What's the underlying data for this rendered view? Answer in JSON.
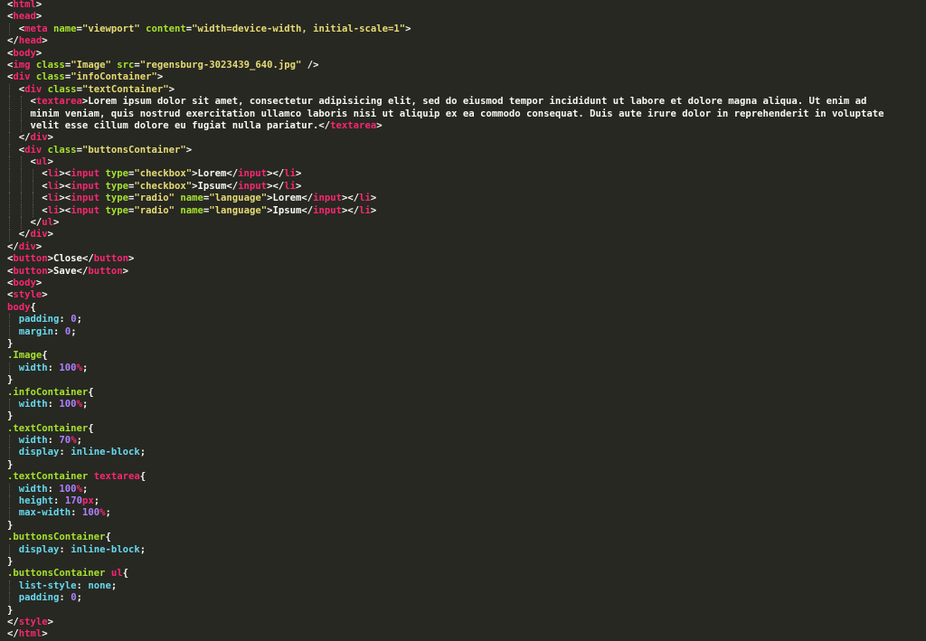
{
  "editor": {
    "colors": {
      "background": "#272822",
      "text": "#f8f8f2",
      "tag": "#f92672",
      "attribute": "#a6e22e",
      "string": "#e6db74",
      "property": "#66d9ef",
      "number": "#ae81ff",
      "indent_guide": "#5a5a52"
    },
    "lines": [
      [
        {
          "t": "<",
          "c": "text"
        },
        {
          "t": "html",
          "c": "tag"
        },
        {
          "t": ">",
          "c": "text"
        }
      ],
      [
        {
          "t": "<",
          "c": "text"
        },
        {
          "t": "head",
          "c": "tag"
        },
        {
          "t": ">",
          "c": "text"
        }
      ],
      [
        {
          "t": "  <",
          "c": "text"
        },
        {
          "t": "meta",
          "c": "tag"
        },
        {
          "t": " name",
          "c": "attribute"
        },
        {
          "t": "=",
          "c": "text"
        },
        {
          "t": "\"viewport\"",
          "c": "string"
        },
        {
          "t": " content",
          "c": "attribute"
        },
        {
          "t": "=",
          "c": "text"
        },
        {
          "t": "\"width=device-width, initial-scale=1\"",
          "c": "string"
        },
        {
          "t": ">",
          "c": "text"
        }
      ],
      [
        {
          "t": "</",
          "c": "text"
        },
        {
          "t": "head",
          "c": "tag"
        },
        {
          "t": ">",
          "c": "text"
        }
      ],
      [
        {
          "t": "<",
          "c": "text"
        },
        {
          "t": "body",
          "c": "tag"
        },
        {
          "t": ">",
          "c": "text"
        }
      ],
      [
        {
          "t": "<",
          "c": "text"
        },
        {
          "t": "img",
          "c": "tag"
        },
        {
          "t": " class",
          "c": "attribute"
        },
        {
          "t": "=",
          "c": "text"
        },
        {
          "t": "\"Image\"",
          "c": "string"
        },
        {
          "t": " src",
          "c": "attribute"
        },
        {
          "t": "=",
          "c": "text"
        },
        {
          "t": "\"regensburg-3023439_640.jpg\"",
          "c": "string"
        },
        {
          "t": " />",
          "c": "text"
        }
      ],
      [
        {
          "t": "<",
          "c": "text"
        },
        {
          "t": "div",
          "c": "tag"
        },
        {
          "t": " class",
          "c": "attribute"
        },
        {
          "t": "=",
          "c": "text"
        },
        {
          "t": "\"infoContainer\"",
          "c": "string"
        },
        {
          "t": ">",
          "c": "text"
        }
      ],
      [
        {
          "t": "  <",
          "c": "text"
        },
        {
          "t": "div",
          "c": "tag"
        },
        {
          "t": " class",
          "c": "attribute"
        },
        {
          "t": "=",
          "c": "text"
        },
        {
          "t": "\"textContainer\"",
          "c": "string"
        },
        {
          "t": ">",
          "c": "text"
        }
      ],
      [
        {
          "t": "    <",
          "c": "text"
        },
        {
          "t": "textarea",
          "c": "tag"
        },
        {
          "t": ">Lorem ipsum dolor sit amet, consectetur adipisicing elit, sed do eiusmod tempor incididunt ut labore et dolore magna aliqua. Ut enim ad",
          "c": "text"
        }
      ],
      [
        {
          "t": "    minim veniam, quis nostrud exercitation ullamco laboris nisi ut aliquip ex ea commodo consequat. Duis aute irure dolor in reprehenderit in voluptate",
          "c": "text"
        }
      ],
      [
        {
          "t": "    velit esse cillum dolore eu fugiat nulla pariatur.</",
          "c": "text"
        },
        {
          "t": "textarea",
          "c": "tag"
        },
        {
          "t": ">",
          "c": "text"
        }
      ],
      [
        {
          "t": "  </",
          "c": "text"
        },
        {
          "t": "div",
          "c": "tag"
        },
        {
          "t": ">",
          "c": "text"
        }
      ],
      [
        {
          "t": "  <",
          "c": "text"
        },
        {
          "t": "div",
          "c": "tag"
        },
        {
          "t": " class",
          "c": "attribute"
        },
        {
          "t": "=",
          "c": "text"
        },
        {
          "t": "\"buttonsContainer\"",
          "c": "string"
        },
        {
          "t": ">",
          "c": "text"
        }
      ],
      [
        {
          "t": "    <",
          "c": "text"
        },
        {
          "t": "ul",
          "c": "tag"
        },
        {
          "t": ">",
          "c": "text"
        }
      ],
      [
        {
          "t": "      <",
          "c": "text"
        },
        {
          "t": "li",
          "c": "tag"
        },
        {
          "t": "><",
          "c": "text"
        },
        {
          "t": "input",
          "c": "tag"
        },
        {
          "t": " type",
          "c": "attribute"
        },
        {
          "t": "=",
          "c": "text"
        },
        {
          "t": "\"checkbox\"",
          "c": "string"
        },
        {
          "t": ">Lorem</",
          "c": "text"
        },
        {
          "t": "input",
          "c": "tag"
        },
        {
          "t": "></",
          "c": "text"
        },
        {
          "t": "li",
          "c": "tag"
        },
        {
          "t": ">",
          "c": "text"
        }
      ],
      [
        {
          "t": "      <",
          "c": "text"
        },
        {
          "t": "li",
          "c": "tag"
        },
        {
          "t": "><",
          "c": "text"
        },
        {
          "t": "input",
          "c": "tag"
        },
        {
          "t": " type",
          "c": "attribute"
        },
        {
          "t": "=",
          "c": "text"
        },
        {
          "t": "\"checkbox\"",
          "c": "string"
        },
        {
          "t": ">Ipsum</",
          "c": "text"
        },
        {
          "t": "input",
          "c": "tag"
        },
        {
          "t": "></",
          "c": "text"
        },
        {
          "t": "li",
          "c": "tag"
        },
        {
          "t": ">",
          "c": "text"
        }
      ],
      [
        {
          "t": "      <",
          "c": "text"
        },
        {
          "t": "li",
          "c": "tag"
        },
        {
          "t": "><",
          "c": "text"
        },
        {
          "t": "input",
          "c": "tag"
        },
        {
          "t": " type",
          "c": "attribute"
        },
        {
          "t": "=",
          "c": "text"
        },
        {
          "t": "\"radio\"",
          "c": "string"
        },
        {
          "t": " name",
          "c": "attribute"
        },
        {
          "t": "=",
          "c": "text"
        },
        {
          "t": "\"language\"",
          "c": "string"
        },
        {
          "t": ">Lorem</",
          "c": "text"
        },
        {
          "t": "input",
          "c": "tag"
        },
        {
          "t": "></",
          "c": "text"
        },
        {
          "t": "li",
          "c": "tag"
        },
        {
          "t": ">",
          "c": "text"
        }
      ],
      [
        {
          "t": "      <",
          "c": "text"
        },
        {
          "t": "li",
          "c": "tag"
        },
        {
          "t": "><",
          "c": "text"
        },
        {
          "t": "input",
          "c": "tag"
        },
        {
          "t": " type",
          "c": "attribute"
        },
        {
          "t": "=",
          "c": "text"
        },
        {
          "t": "\"radio\"",
          "c": "string"
        },
        {
          "t": " name",
          "c": "attribute"
        },
        {
          "t": "=",
          "c": "text"
        },
        {
          "t": "\"language\"",
          "c": "string"
        },
        {
          "t": ">Ipsum</",
          "c": "text"
        },
        {
          "t": "input",
          "c": "tag"
        },
        {
          "t": "></",
          "c": "text"
        },
        {
          "t": "li",
          "c": "tag"
        },
        {
          "t": ">",
          "c": "text"
        }
      ],
      [
        {
          "t": "    </",
          "c": "text"
        },
        {
          "t": "ul",
          "c": "tag"
        },
        {
          "t": ">",
          "c": "text"
        }
      ],
      [
        {
          "t": "  </",
          "c": "text"
        },
        {
          "t": "div",
          "c": "tag"
        },
        {
          "t": ">",
          "c": "text"
        }
      ],
      [
        {
          "t": "</",
          "c": "text"
        },
        {
          "t": "div",
          "c": "tag"
        },
        {
          "t": ">",
          "c": "text"
        }
      ],
      [
        {
          "t": "<",
          "c": "text"
        },
        {
          "t": "button",
          "c": "tag"
        },
        {
          "t": ">Close</",
          "c": "text"
        },
        {
          "t": "button",
          "c": "tag"
        },
        {
          "t": ">",
          "c": "text"
        }
      ],
      [
        {
          "t": "<",
          "c": "text"
        },
        {
          "t": "button",
          "c": "tag"
        },
        {
          "t": ">Save</",
          "c": "text"
        },
        {
          "t": "button",
          "c": "tag"
        },
        {
          "t": ">",
          "c": "text"
        }
      ],
      [
        {
          "t": "<",
          "c": "text"
        },
        {
          "t": "body",
          "c": "tag"
        },
        {
          "t": ">",
          "c": "text"
        }
      ],
      [
        {
          "t": "<",
          "c": "text"
        },
        {
          "t": "style",
          "c": "tag"
        },
        {
          "t": ">",
          "c": "text"
        }
      ],
      [
        {
          "t": "body",
          "c": "tag"
        },
        {
          "t": "{",
          "c": "text"
        }
      ],
      [
        {
          "t": "  ",
          "c": "text"
        },
        {
          "t": "padding",
          "c": "property"
        },
        {
          "t": ": ",
          "c": "text"
        },
        {
          "t": "0",
          "c": "number"
        },
        {
          "t": ";",
          "c": "text"
        }
      ],
      [
        {
          "t": "  ",
          "c": "text"
        },
        {
          "t": "margin",
          "c": "property"
        },
        {
          "t": ": ",
          "c": "text"
        },
        {
          "t": "0",
          "c": "number"
        },
        {
          "t": ";",
          "c": "text"
        }
      ],
      [
        {
          "t": "}",
          "c": "text"
        }
      ],
      [
        {
          "t": ".Image",
          "c": "attribute"
        },
        {
          "t": "{",
          "c": "text"
        }
      ],
      [
        {
          "t": "  ",
          "c": "text"
        },
        {
          "t": "width",
          "c": "property"
        },
        {
          "t": ": ",
          "c": "text"
        },
        {
          "t": "100",
          "c": "number"
        },
        {
          "t": "%",
          "c": "tag"
        },
        {
          "t": ";",
          "c": "text"
        }
      ],
      [
        {
          "t": "}",
          "c": "text"
        }
      ],
      [
        {
          "t": ".infoContainer",
          "c": "attribute"
        },
        {
          "t": "{",
          "c": "text"
        }
      ],
      [
        {
          "t": "  ",
          "c": "text"
        },
        {
          "t": "width",
          "c": "property"
        },
        {
          "t": ": ",
          "c": "text"
        },
        {
          "t": "100",
          "c": "number"
        },
        {
          "t": "%",
          "c": "tag"
        },
        {
          "t": ";",
          "c": "text"
        }
      ],
      [
        {
          "t": "}",
          "c": "text"
        }
      ],
      [
        {
          "t": ".textContainer",
          "c": "attribute"
        },
        {
          "t": "{",
          "c": "text"
        }
      ],
      [
        {
          "t": "  ",
          "c": "text"
        },
        {
          "t": "width",
          "c": "property"
        },
        {
          "t": ": ",
          "c": "text"
        },
        {
          "t": "70",
          "c": "number"
        },
        {
          "t": "%",
          "c": "tag"
        },
        {
          "t": ";",
          "c": "text"
        }
      ],
      [
        {
          "t": "  ",
          "c": "text"
        },
        {
          "t": "display",
          "c": "property"
        },
        {
          "t": ": ",
          "c": "text"
        },
        {
          "t": "inline-block",
          "c": "property"
        },
        {
          "t": ";",
          "c": "text"
        }
      ],
      [
        {
          "t": "}",
          "c": "text"
        }
      ],
      [
        {
          "t": ".textContainer",
          "c": "attribute"
        },
        {
          "t": " ",
          "c": "text"
        },
        {
          "t": "textarea",
          "c": "tag"
        },
        {
          "t": "{",
          "c": "text"
        }
      ],
      [
        {
          "t": "  ",
          "c": "text"
        },
        {
          "t": "width",
          "c": "property"
        },
        {
          "t": ": ",
          "c": "text"
        },
        {
          "t": "100",
          "c": "number"
        },
        {
          "t": "%",
          "c": "tag"
        },
        {
          "t": ";",
          "c": "text"
        }
      ],
      [
        {
          "t": "  ",
          "c": "text"
        },
        {
          "t": "height",
          "c": "property"
        },
        {
          "t": ": ",
          "c": "text"
        },
        {
          "t": "170",
          "c": "number"
        },
        {
          "t": "px",
          "c": "tag"
        },
        {
          "t": ";",
          "c": "text"
        }
      ],
      [
        {
          "t": "  ",
          "c": "text"
        },
        {
          "t": "max-width",
          "c": "property"
        },
        {
          "t": ": ",
          "c": "text"
        },
        {
          "t": "100",
          "c": "number"
        },
        {
          "t": "%",
          "c": "tag"
        },
        {
          "t": ";",
          "c": "text"
        }
      ],
      [
        {
          "t": "}",
          "c": "text"
        }
      ],
      [
        {
          "t": ".buttonsContainer",
          "c": "attribute"
        },
        {
          "t": "{",
          "c": "text"
        }
      ],
      [
        {
          "t": "  ",
          "c": "text"
        },
        {
          "t": "display",
          "c": "property"
        },
        {
          "t": ": ",
          "c": "text"
        },
        {
          "t": "inline-block",
          "c": "property"
        },
        {
          "t": ";",
          "c": "text"
        }
      ],
      [
        {
          "t": "}",
          "c": "text"
        }
      ],
      [
        {
          "t": ".buttonsContainer",
          "c": "attribute"
        },
        {
          "t": " ",
          "c": "text"
        },
        {
          "t": "ul",
          "c": "tag"
        },
        {
          "t": "{",
          "c": "text"
        }
      ],
      [
        {
          "t": "  ",
          "c": "text"
        },
        {
          "t": "list-style",
          "c": "property"
        },
        {
          "t": ": ",
          "c": "text"
        },
        {
          "t": "none",
          "c": "property"
        },
        {
          "t": ";",
          "c": "text"
        }
      ],
      [
        {
          "t": "  ",
          "c": "text"
        },
        {
          "t": "padding",
          "c": "property"
        },
        {
          "t": ": ",
          "c": "text"
        },
        {
          "t": "0",
          "c": "number"
        },
        {
          "t": ";",
          "c": "text"
        }
      ],
      [
        {
          "t": "}",
          "c": "text"
        }
      ],
      [
        {
          "t": "</",
          "c": "text"
        },
        {
          "t": "style",
          "c": "tag"
        },
        {
          "t": ">",
          "c": "text"
        }
      ],
      [
        {
          "t": "</",
          "c": "text"
        },
        {
          "t": "html",
          "c": "tag"
        },
        {
          "t": ">",
          "c": "text"
        }
      ]
    ]
  }
}
